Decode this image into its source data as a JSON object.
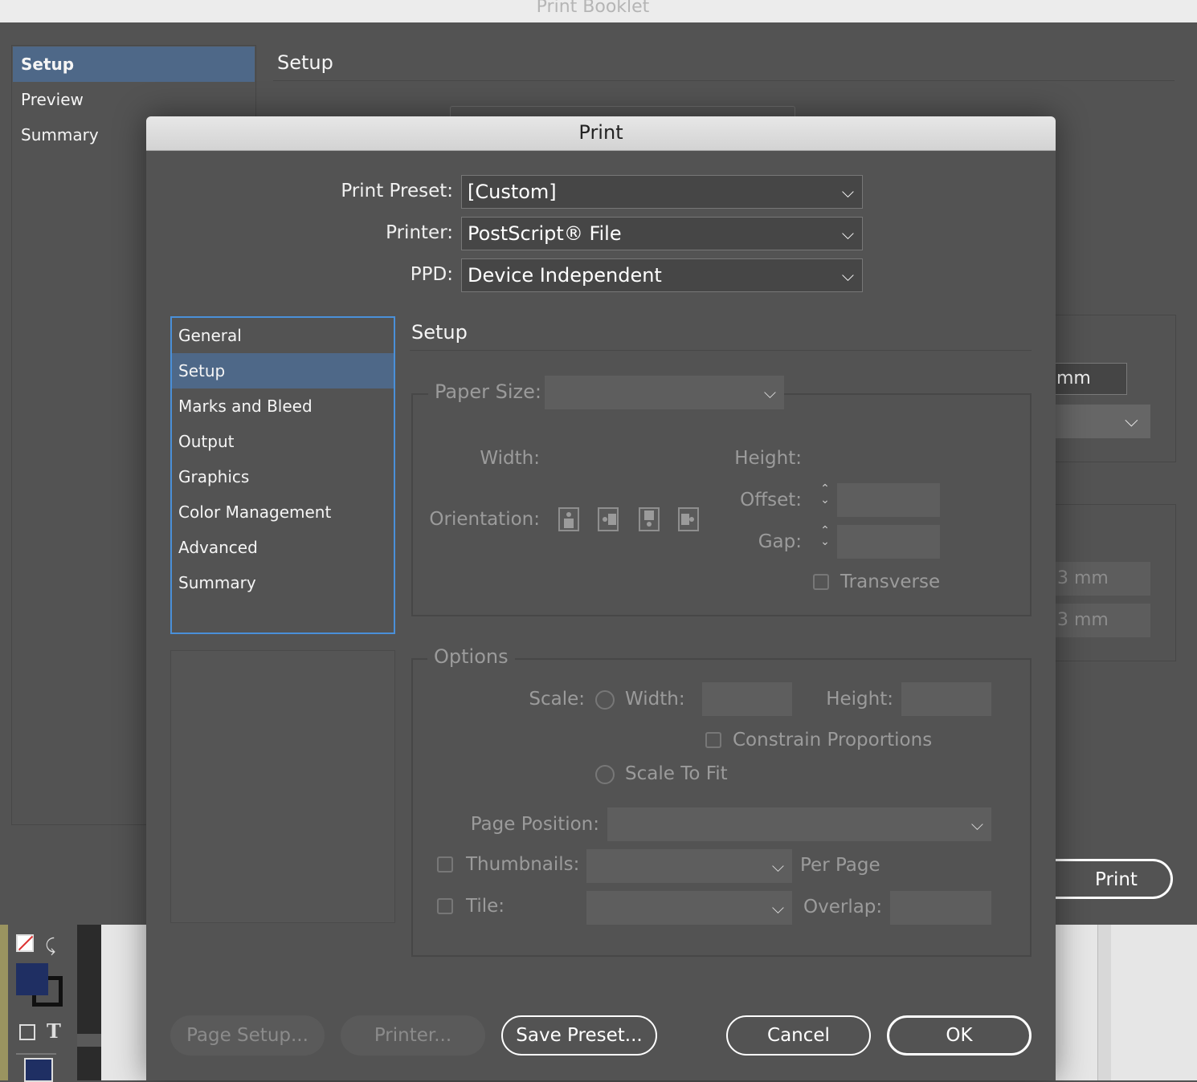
{
  "booklet": {
    "title": "Print Booklet",
    "nav": [
      "Setup",
      "Preview",
      "Summary"
    ],
    "setup_heading": "Setup",
    "mm_field": "mm",
    "field_a": "3 mm",
    "field_b": "3 mm",
    "print_button": "Print"
  },
  "dialog": {
    "title": "Print",
    "preset_label": "Print Preset:",
    "preset_value": "[Custom]",
    "printer_label": "Printer:",
    "printer_value": "PostScript® File",
    "ppd_label": "PPD:",
    "ppd_value": "Device Independent",
    "categories": [
      "General",
      "Setup",
      "Marks and Bleed",
      "Output",
      "Graphics",
      "Color Management",
      "Advanced",
      "Summary"
    ],
    "selected_category": "Setup",
    "section_title": "Setup",
    "paper": {
      "label": "Paper Size:",
      "width_label": "Width:",
      "height_label": "Height:",
      "offset_label": "Offset:",
      "gap_label": "Gap:",
      "orientation_label": "Orientation:",
      "transverse_label": "Transverse"
    },
    "options": {
      "legend": "Options",
      "scale_label": "Scale:",
      "width_label": "Width:",
      "height_label": "Height:",
      "constrain_label": "Constrain Proportions",
      "scale_to_fit_label": "Scale To Fit",
      "page_position_label": "Page Position:",
      "thumbnails_label": "Thumbnails:",
      "per_page_label": "Per Page",
      "tile_label": "Tile:",
      "overlap_label": "Overlap:"
    },
    "buttons": {
      "page_setup": "Page Setup...",
      "printer": "Printer...",
      "save_preset": "Save Preset...",
      "cancel": "Cancel",
      "ok": "OK"
    }
  },
  "colors": {
    "selection": "#4e6888",
    "focus_ring": "#4a90d9",
    "panel": "#535353"
  }
}
